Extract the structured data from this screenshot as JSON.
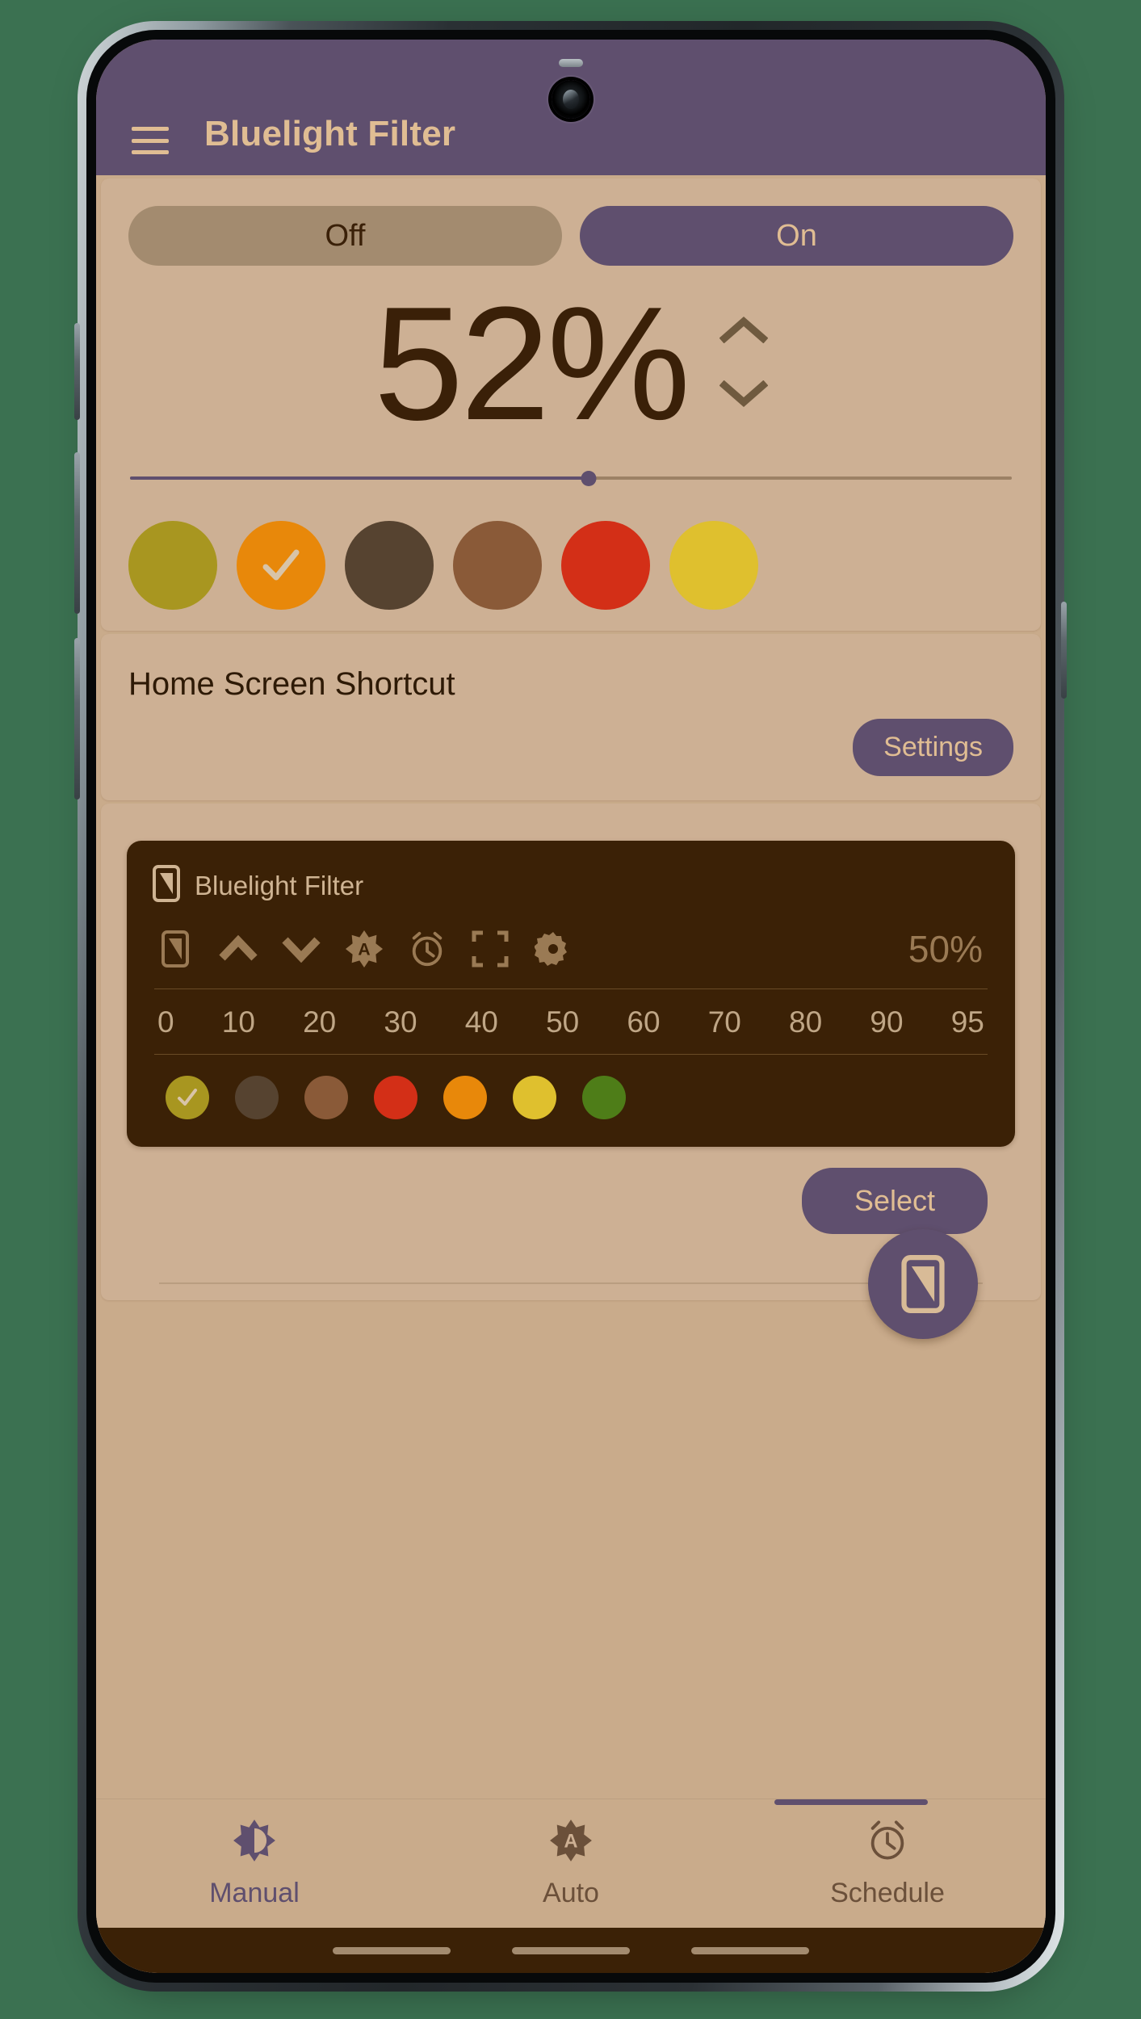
{
  "app": {
    "title": "Bluelight Filter",
    "menu_icon": "hamburger-menu-icon"
  },
  "theme": {
    "accent_purple": "#5f4f6e",
    "screen_bg": "#c9ab8b",
    "card_bg": "#cdb094",
    "tan_text": "#e0bd93",
    "dark_brown": "#3b2106"
  },
  "filter": {
    "off_label": "Off",
    "on_label": "On",
    "active_state": "On",
    "percent_label": "52%",
    "percent_value": 52,
    "slider_value": 52,
    "stepper_up_icon": "chevron-up-icon",
    "stepper_down_icon": "chevron-down-icon",
    "swatches": [
      {
        "name": "olive",
        "color": "#a89620",
        "selected": false
      },
      {
        "name": "orange",
        "color": "#e8880a",
        "selected": true
      },
      {
        "name": "dark-brown",
        "color": "#564330",
        "selected": false
      },
      {
        "name": "medium-brown",
        "color": "#8a5a38",
        "selected": false
      },
      {
        "name": "red",
        "color": "#d32f17",
        "selected": false
      },
      {
        "name": "yellow",
        "color": "#dfc02e",
        "selected": false
      }
    ]
  },
  "shortcut": {
    "title": "Home Screen Shortcut",
    "settings_label": "Settings"
  },
  "preview": {
    "notification_title": "Bluelight Filter",
    "app_icon": "phone-screen-icon",
    "actions": [
      {
        "name": "phone-screen-icon"
      },
      {
        "name": "chevron-up-icon"
      },
      {
        "name": "chevron-down-icon"
      },
      {
        "name": "auto-badge-icon"
      },
      {
        "name": "alarm-clock-icon"
      },
      {
        "name": "fullscreen-icon"
      },
      {
        "name": "gear-icon"
      }
    ],
    "percent_label": "50%",
    "scale": [
      "0",
      "10",
      "20",
      "30",
      "40",
      "50",
      "60",
      "70",
      "80",
      "90",
      "95"
    ],
    "dots": [
      {
        "name": "olive",
        "color": "#a89620",
        "selected": true
      },
      {
        "name": "dark-brown",
        "color": "#564330",
        "selected": false
      },
      {
        "name": "medium-brown",
        "color": "#8a5a38",
        "selected": false
      },
      {
        "name": "red",
        "color": "#d32f17",
        "selected": false
      },
      {
        "name": "orange",
        "color": "#e8880a",
        "selected": false
      },
      {
        "name": "yellow",
        "color": "#dfc02e",
        "selected": false
      },
      {
        "name": "green",
        "color": "#4e7d18",
        "selected": false
      }
    ],
    "select_label": "Select",
    "fab_icon": "phone-screen-icon"
  },
  "bottom_nav": {
    "items": [
      {
        "label": "Manual",
        "icon": "brightness-half-icon",
        "active": true
      },
      {
        "label": "Auto",
        "icon": "auto-badge-icon",
        "active": false
      },
      {
        "label": "Schedule",
        "icon": "alarm-clock-icon",
        "active": false
      }
    ]
  }
}
